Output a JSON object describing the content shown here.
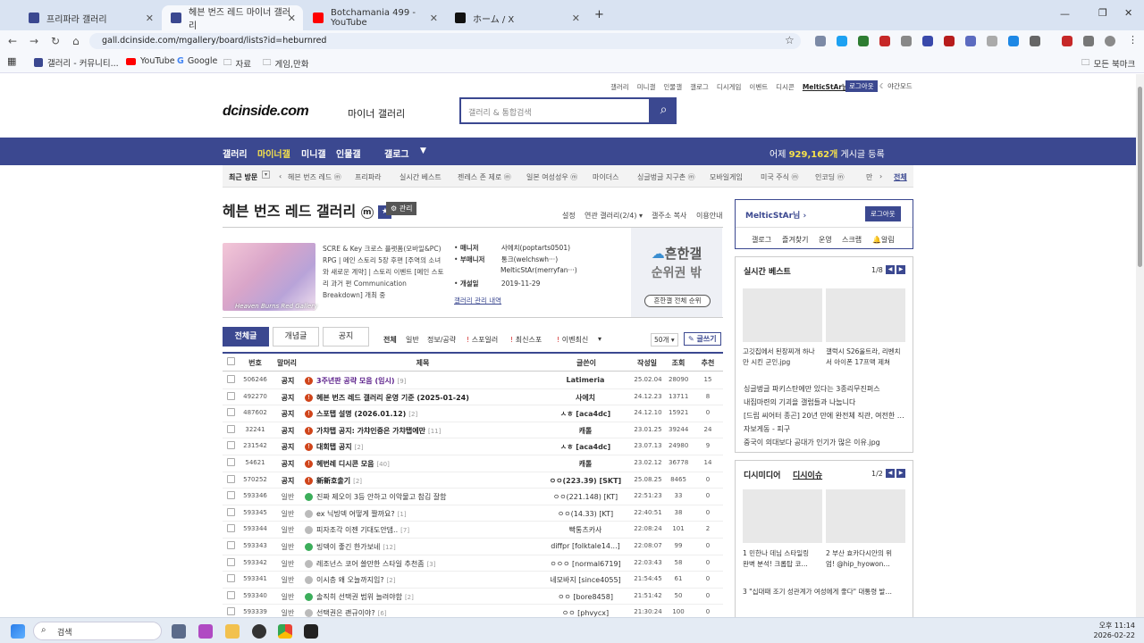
{
  "browser": {
    "tabs": [
      {
        "title": "프리파라 갤러리",
        "fav_color": "#3b4890",
        "active": false
      },
      {
        "title": "헤븐 번즈 레드 마이너 갤러리",
        "fav_color": "#3b4890",
        "active": true
      },
      {
        "title": "Botchamania 499 - YouTube",
        "fav_color": "#ff0000",
        "active": false
      },
      {
        "title": "ホーム / X",
        "fav_color": "#111111",
        "active": false
      }
    ],
    "new_tab_label": "+",
    "url": "gall.dcinside.com/mgallery/board/lists?id=heburnred",
    "bookmarks": [
      "갤러리 - 커뮤니티...",
      "YouTube",
      "Google",
      "자료",
      "게임,만화"
    ],
    "all_bookmarks": "모든 북마크"
  },
  "site": {
    "top_links": [
      "갤러리",
      "미니갤",
      "인물갤",
      "갤로그",
      "디시게임",
      "이벤트",
      "디시콘",
      "MelticStAr님 ▾"
    ],
    "logout": "로그아웃",
    "night_mode": "야간모드",
    "logo": "dcinside.com",
    "logo_sub": "마이너 갤러리",
    "search_placeholder": "갤러리 & 통합검색",
    "gnb": {
      "items": [
        "갤러리",
        "마이너갤",
        "미니갤",
        "인물갤",
        "갤로그"
      ],
      "stat_prefix": "어제",
      "stat_value": "929,162개",
      "stat_suffix": "게시글 등록"
    },
    "recent": {
      "label": "최근 방문",
      "items": [
        "헤븐 번즈 레드 ⓜ",
        "프리파라",
        "실시간 베스트",
        "젠레스 존 제로 ⓜ",
        "일본 여성성우 ⓜ",
        "마이더스",
        "싱글벙글 지구촌 ⓜ",
        "모바일게임",
        "미국 주식 ⓜ",
        "인코딩 ⓜ",
        "만"
      ],
      "all": "전체"
    },
    "gallery": {
      "title": "헤븐 번즈 레드 갤러리",
      "manage": "관리",
      "tools": [
        "설정",
        "연관 갤러리(2/4) ▾",
        "갤주소 복사",
        "이용안내"
      ],
      "desc": "SCRE & Key 크로스 플랫폼(모바일&PC) RPG | 메인 스토리 5장 후편 [주역의 소녀와 새로운 계약] | 스토리 이벤트 [메인 스토리 과거 편 Communication Breakdown] 개최 중",
      "thumb_caption": "Heaven Burns Red Gallery",
      "managers": [
        {
          "label": "매니저",
          "value": "사에치(poptarts0501)"
        },
        {
          "label": "부매니저",
          "value": "통크(welchswh···)"
        },
        {
          "label": "",
          "value": "MelticStAr(merryfan···)"
        },
        {
          "label": "개설일",
          "value": "2019-11-29"
        }
      ],
      "history": "갤러리 관리 내역",
      "rank1": "흔한갤",
      "rank2": "순위권 밖",
      "rank_btn": "흔한갤 전체 순위"
    },
    "board_tabs": [
      "전체글",
      "개념글",
      "공지"
    ],
    "sub_tabs": [
      "전체",
      "일반",
      "정보/공략",
      "스포일러",
      "최신스포",
      "이벤최신"
    ],
    "per_page": "50개 ▾",
    "write": "글쓰기",
    "columns": [
      "번호",
      "말머리",
      "제목",
      "글쓴이",
      "작성일",
      "조회",
      "추천"
    ],
    "rows": [
      {
        "no": "506246",
        "head": "공지",
        "title": "3주년판 공략 모음 (임시)",
        "reply": "[9]",
        "writer": "Latimeria",
        "date": "25.02.04",
        "views": "28090",
        "rec": "15",
        "notice": true,
        "color": "#5b1f8a"
      },
      {
        "no": "492270",
        "head": "공지",
        "title": "헤븐 번즈 레드 갤러리 운영 기준 (2025-01-24)",
        "reply": "",
        "writer": "사에치",
        "date": "24.12.23",
        "views": "13711",
        "rec": "8",
        "notice": true,
        "color": "#222"
      },
      {
        "no": "487602",
        "head": "공지",
        "title": "스포탭 설명 (2026.01.12)",
        "reply": "[2]",
        "writer": "ㅅㅎ [aca4dc]",
        "date": "24.12.10",
        "views": "15921",
        "rec": "0",
        "notice": true,
        "color": "#222"
      },
      {
        "no": "32241",
        "head": "공지",
        "title": "가챠탭 공지: 가챠인증은 가챠탭에만",
        "reply": "[11]",
        "writer": "캐톨",
        "date": "23.01.25",
        "views": "39244",
        "rec": "24",
        "notice": true,
        "color": "#222"
      },
      {
        "no": "231542",
        "head": "공지",
        "title": "대회탭 공지",
        "reply": "[2]",
        "writer": "ㅅㅎ [aca4dc]",
        "date": "23.07.13",
        "views": "24980",
        "rec": "9",
        "notice": true,
        "color": "#222"
      },
      {
        "no": "54621",
        "head": "공지",
        "title": "헤번레 디시콘 모음",
        "reply": "[40]",
        "writer": "캐톨",
        "date": "23.02.12",
        "views": "36778",
        "rec": "14",
        "notice": true,
        "color": "#222"
      },
      {
        "no": "570252",
        "head": "공지",
        "title": "新新호출기",
        "reply": "[2]",
        "writer": "ㅇㅇ(223.39) [SKT]",
        "date": "25.08.25",
        "views": "8465",
        "rec": "0",
        "notice": true,
        "color": "#222"
      },
      {
        "no": "593346",
        "head": "일반",
        "title": "진짜 제오이 3등 안하고 이악물고 참김 잘함",
        "reply": "",
        "writer": "ㅇㅇ(221.148) [KT]",
        "date": "22:51:23",
        "views": "33",
        "rec": "0",
        "notice": false,
        "color": "#333"
      },
      {
        "no": "593345",
        "head": "일반",
        "title": "ex 닉빙덱 어떻게 짤까요?",
        "reply": "[1]",
        "writer": "ㅇㅇ(14.33) [KT]",
        "date": "22:40:51",
        "views": "38",
        "rec": "0",
        "notice": false,
        "color": "#333"
      },
      {
        "no": "593344",
        "head": "일반",
        "title": "피자조각 이젠 기대도안댐..",
        "reply": "[7]",
        "writer": "빡통츠카사",
        "date": "22:08:24",
        "views": "101",
        "rec": "2",
        "notice": false,
        "color": "#333"
      },
      {
        "no": "593343",
        "head": "일반",
        "title": "빙덱이 좋긴 한가보네",
        "reply": "[12]",
        "writer": "diffpr [folktale14...]",
        "date": "22:08:07",
        "views": "99",
        "rec": "0",
        "notice": false,
        "color": "#333"
      },
      {
        "no": "593342",
        "head": "일반",
        "title": "레조넌스 코어 쓸만한 스타일 추천좀",
        "reply": "[3]",
        "writer": "ㅇㅇㅇ [normal6719]",
        "date": "22:03:43",
        "views": "58",
        "rec": "0",
        "notice": false,
        "color": "#333"
      },
      {
        "no": "593341",
        "head": "일반",
        "title": "이시층 왜 오늘까지임?",
        "reply": "[2]",
        "writer": "네모바지 [since4055]",
        "date": "21:54:45",
        "views": "61",
        "rec": "0",
        "notice": false,
        "color": "#333"
      },
      {
        "no": "593340",
        "head": "일반",
        "title": "솔직히 선택권 범위 늘려야함",
        "reply": "[2]",
        "writer": "ㅇㅇ [bore8458]",
        "date": "21:51:42",
        "views": "50",
        "rec": "0",
        "notice": false,
        "color": "#333"
      },
      {
        "no": "593339",
        "head": "일반",
        "title": "선택권은 괜규이야?",
        "reply": "[6]",
        "writer": "ㅇㅇ [phvycx]",
        "date": "21:30:24",
        "views": "100",
        "rec": "0",
        "notice": false,
        "color": "#333"
      }
    ],
    "side": {
      "user": "MelticStAr님",
      "logout": "로그아웃",
      "menu": [
        "갤로그",
        "즐겨찾기",
        "운영",
        "스크랩",
        "알림"
      ],
      "best_title": "실시간 베스트",
      "best_page": "1/8",
      "best_caps": [
        [
          "고깃집에서 된장찌개 하나",
          "만 시킨 군인.jpg"
        ],
        [
          "갤럭시 S26울트라, 리벤치",
          "서 아이폰 17프맥 제쳐"
        ]
      ],
      "best_list": [
        "싱글벙글 파키스탄에만 있다는 3종리무진퍼스",
        "내집마련의 기괴을 갤럽들과 나눕니다",
        "[드립 씨어터 종곤] 20년 만에 완전체 직관, 여전한 …",
        "자보게동 - 피구",
        "중국이 의대보다 공대가 인기가 많은 이유.jpg"
      ],
      "issue_title": "디시미디어",
      "issue_title2": "디시이슈",
      "issue_page": "1/2",
      "issue_caps": [
        [
          "1  민한나 데님 스타일링",
          "완벽 분석! 크롭탑 코…"
        ],
        [
          "2  부산 효카다시안의 위",
          "엄! @hip_hyowon…"
        ]
      ],
      "issue_list": [
        "3  \"십대때 조기 성관계가 여성에게 좋다\" 대통령 발…"
      ]
    }
  },
  "taskbar": {
    "search": "검색",
    "time": "오후 11:14",
    "date": "2026-02-22"
  }
}
